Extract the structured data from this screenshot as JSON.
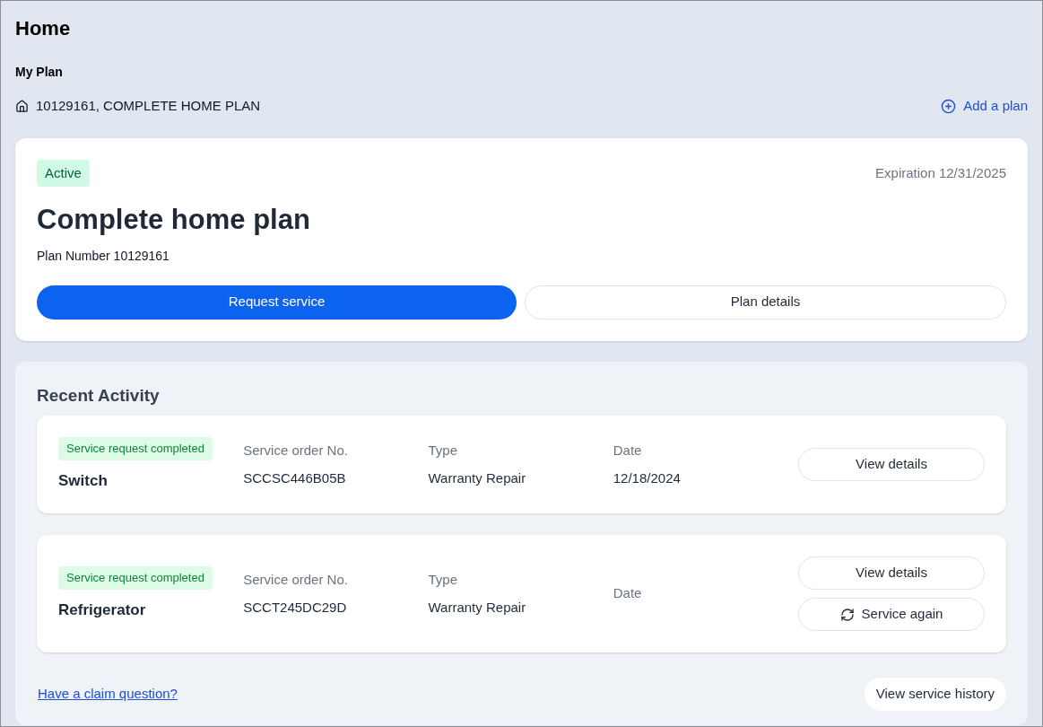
{
  "page": {
    "title": "Home"
  },
  "my_plan": {
    "heading": "My Plan",
    "plan_label": "10129161, COMPLETE HOME PLAN",
    "add_link": "Add a plan"
  },
  "plan_card": {
    "status": "Active",
    "expiration": "Expiration 12/31/2025",
    "title": "Complete home plan",
    "plan_number": "Plan Number 10129161",
    "buttons": [
      {
        "label": "Request service",
        "kind": "primary"
      },
      {
        "label": "Plan details",
        "kind": "secondary"
      }
    ]
  },
  "recent_activity": {
    "heading": "Recent Activity",
    "items": [
      {
        "status": "Service request completed",
        "name": "Switch",
        "order_label": "Service order No.",
        "order_value": "SCCSC446B05B",
        "type_label": "Type",
        "type_value": "Warranty Repair",
        "date_label": "Date",
        "date_value": "12/18/2024",
        "buttons": [
          {
            "label": "View details",
            "kind": "plain"
          }
        ]
      },
      {
        "status": "Service request completed",
        "name": "Refrigerator",
        "order_label": "Service order No.",
        "order_value": "SCCT245DC29D",
        "type_label": "Type",
        "type_value": "Warranty Repair",
        "date_label": "Date",
        "buttons": [
          {
            "label": "View details",
            "kind": "plain"
          },
          {
            "label": "Service again",
            "kind": "repeat"
          }
        ]
      }
    ],
    "claim_link": "Have a claim question?",
    "history_button": "View service history"
  }
}
